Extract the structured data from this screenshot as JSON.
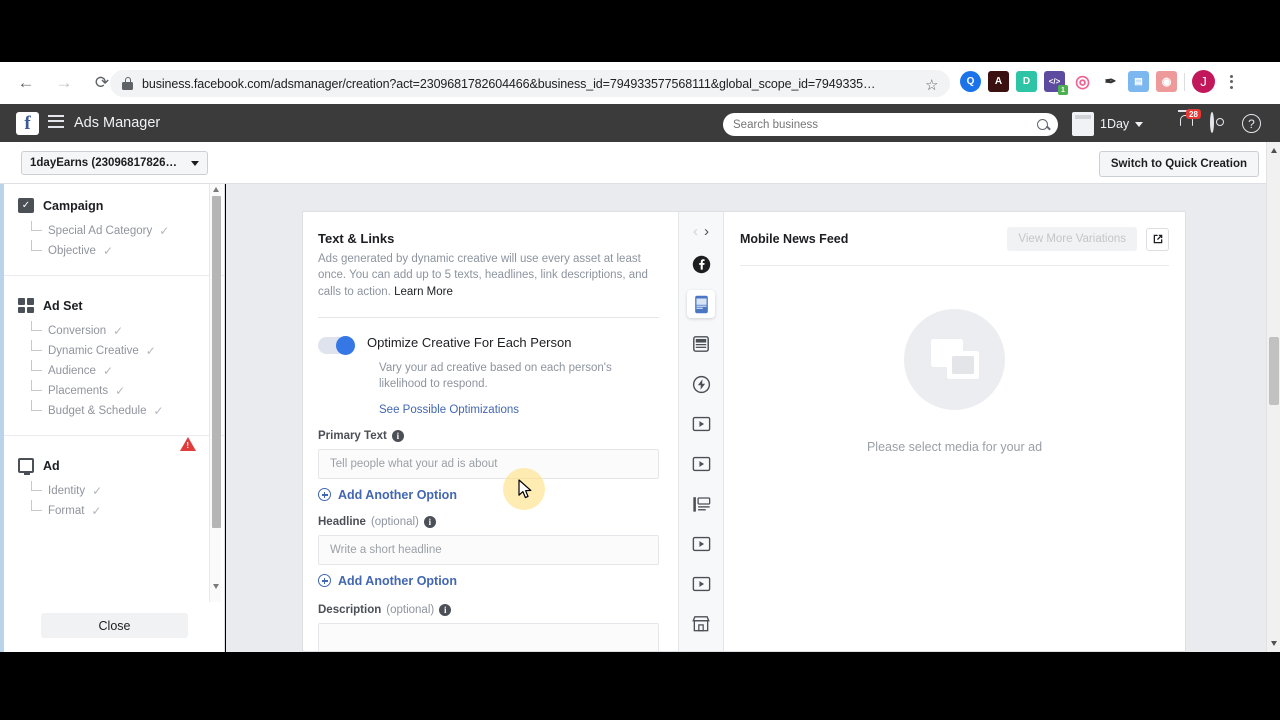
{
  "browser": {
    "url": "business.facebook.com/adsmanager/creation?act=2309681782604466&business_id=794933577568111&global_scope_id=7949335…",
    "back_icon": "back-arrow-icon",
    "forward_icon": "forward-arrow-icon",
    "reload_icon": "reload-icon",
    "lock_icon": "lock-icon",
    "star_icon": "☆",
    "profile_initial": "J",
    "extensions": [
      {
        "name": "search-extension-icon",
        "glyph": "Q",
        "bg": "#1a73e8",
        "badge": ""
      },
      {
        "name": "adobe-acrobat-extension-icon",
        "glyph": "A",
        "bg": "#3b1010",
        "badge": ""
      },
      {
        "name": "grammarly-extension-icon",
        "glyph": "D",
        "bg": "#2ec4a6",
        "badge": ""
      },
      {
        "name": "code-extension-icon",
        "glyph": "</>",
        "bg": "#5c4b9e",
        "badge": "1"
      },
      {
        "name": "spiral-extension-icon",
        "glyph": "◎",
        "bg": "#f48fb1",
        "badge": ""
      },
      {
        "name": "eyedropper-extension-icon",
        "glyph": "✒",
        "bg": "#3a3a3a",
        "badge": ""
      },
      {
        "name": "bluetext-extension-icon",
        "glyph": "B",
        "bg": "#64b5f6",
        "badge": ""
      },
      {
        "name": "camera-extension-icon",
        "glyph": "◉",
        "bg": "#e57373",
        "badge": ""
      }
    ]
  },
  "fbbar": {
    "logo": "facebook-logo",
    "title": "Ads Manager",
    "search_placeholder": "Search business",
    "date_label": "1Day",
    "notification_count": "28"
  },
  "subheader": {
    "account_selector": "1dayEarns (23096817826…",
    "quick_creation_button": "Switch to Quick Creation"
  },
  "sidebar": {
    "groups": [
      {
        "title": "Campaign",
        "icon": "campaign-checkbox-icon",
        "items": [
          {
            "label": "Special Ad Category",
            "check": "✓"
          },
          {
            "label": "Objective",
            "check": "✓"
          }
        ]
      },
      {
        "title": "Ad Set",
        "icon": "adset-grid-icon",
        "items": [
          {
            "label": "Conversion",
            "check": "✓"
          },
          {
            "label": "Dynamic Creative",
            "check": "✓"
          },
          {
            "label": "Audience",
            "check": "✓"
          },
          {
            "label": "Placements",
            "check": "✓"
          },
          {
            "label": "Budget & Schedule",
            "check": "✓"
          }
        ]
      },
      {
        "title": "Ad",
        "icon": "ad-monitor-icon",
        "warning": "warning-triangle-icon",
        "items": [
          {
            "label": "Identity",
            "check": "✓"
          },
          {
            "label": "Format",
            "check": "✓"
          }
        ]
      }
    ],
    "close_button": "Close"
  },
  "form": {
    "section_title": "Text & Links",
    "section_description": "Ads generated by dynamic creative will use every asset at least once. You can add up to 5 texts, headlines, link descriptions, and calls to action.",
    "learn_more": "Learn More",
    "toggle": {
      "label": "Optimize Creative For Each Person",
      "state": "on",
      "description": "Vary your ad creative based on each person's likelihood to respond.",
      "link": "See Possible Optimizations",
      "accent_color": "#3578e5"
    },
    "fields": [
      {
        "label": "Primary Text",
        "optional": "",
        "placeholder": "Tell people what your ad is about",
        "value": "",
        "add_option": "Add Another Option"
      },
      {
        "label": "Headline",
        "optional": "(optional)",
        "placeholder": "Write a short headline",
        "value": "",
        "add_option": "Add Another Option"
      },
      {
        "label": "Description",
        "optional": "(optional)",
        "placeholder": "",
        "value": "",
        "add_option": ""
      }
    ]
  },
  "rail": {
    "prev_icon": "chevron-left-icon",
    "next_icon": "chevron-right-icon",
    "placements": [
      {
        "name": "facebook-logo-icon",
        "selected": false
      },
      {
        "name": "mobile-news-feed-icon",
        "selected": true
      },
      {
        "name": "desktop-news-feed-icon",
        "selected": false
      },
      {
        "name": "instant-article-icon",
        "selected": false
      },
      {
        "name": "in-stream-video-icon",
        "selected": false
      },
      {
        "name": "video-feeds-icon",
        "selected": false
      },
      {
        "name": "right-column-icon",
        "selected": false
      },
      {
        "name": "video-placement-icon",
        "selected": false
      },
      {
        "name": "suggested-video-icon",
        "selected": false
      },
      {
        "name": "marketplace-icon",
        "selected": false
      },
      {
        "name": "stories-icon",
        "selected": false
      }
    ]
  },
  "preview": {
    "title": "Mobile News Feed",
    "variations_button": "View More Variations",
    "open_icon": "open-external-icon",
    "placeholder_icon": "media-placeholder-icon",
    "empty_message": "Please select media for your ad"
  }
}
